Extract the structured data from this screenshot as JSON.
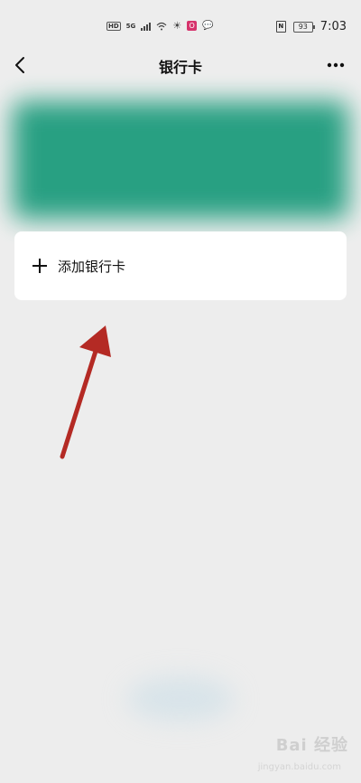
{
  "status_bar": {
    "hd": "HD",
    "network": "5G",
    "app_badge": "O",
    "nfc": "N",
    "battery": "93",
    "time": "7:03"
  },
  "header": {
    "title": "银行卡"
  },
  "add_card": {
    "label": "添加银行卡"
  },
  "watermark": {
    "text": "Bai 经验",
    "sub": "jingyan.baidu.com"
  },
  "colors": {
    "card_accent": "#1e9c7d",
    "arrow": "#b42a24",
    "background": "#ededed"
  },
  "icons": [
    "back-icon",
    "more-icon",
    "plus-icon",
    "wifi-icon",
    "signal-icon",
    "battery-icon"
  ]
}
